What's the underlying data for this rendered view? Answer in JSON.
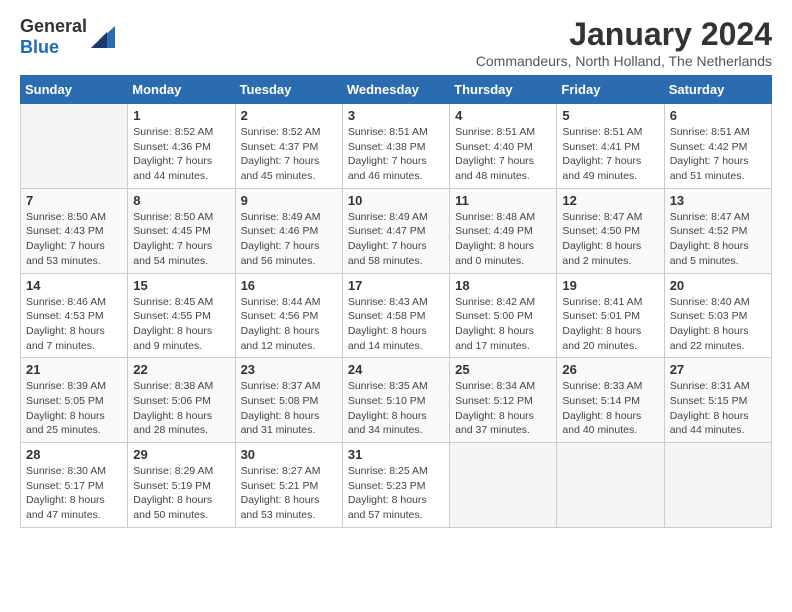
{
  "logo": {
    "general": "General",
    "blue": "Blue"
  },
  "header": {
    "month_title": "January 2024",
    "subtitle": "Commandeurs, North Holland, The Netherlands"
  },
  "days_of_week": [
    "Sunday",
    "Monday",
    "Tuesday",
    "Wednesday",
    "Thursday",
    "Friday",
    "Saturday"
  ],
  "weeks": [
    [
      {
        "day": "",
        "info": ""
      },
      {
        "day": "1",
        "info": "Sunrise: 8:52 AM\nSunset: 4:36 PM\nDaylight: 7 hours\nand 44 minutes."
      },
      {
        "day": "2",
        "info": "Sunrise: 8:52 AM\nSunset: 4:37 PM\nDaylight: 7 hours\nand 45 minutes."
      },
      {
        "day": "3",
        "info": "Sunrise: 8:51 AM\nSunset: 4:38 PM\nDaylight: 7 hours\nand 46 minutes."
      },
      {
        "day": "4",
        "info": "Sunrise: 8:51 AM\nSunset: 4:40 PM\nDaylight: 7 hours\nand 48 minutes."
      },
      {
        "day": "5",
        "info": "Sunrise: 8:51 AM\nSunset: 4:41 PM\nDaylight: 7 hours\nand 49 minutes."
      },
      {
        "day": "6",
        "info": "Sunrise: 8:51 AM\nSunset: 4:42 PM\nDaylight: 7 hours\nand 51 minutes."
      }
    ],
    [
      {
        "day": "7",
        "info": "Sunrise: 8:50 AM\nSunset: 4:43 PM\nDaylight: 7 hours\nand 53 minutes."
      },
      {
        "day": "8",
        "info": "Sunrise: 8:50 AM\nSunset: 4:45 PM\nDaylight: 7 hours\nand 54 minutes."
      },
      {
        "day": "9",
        "info": "Sunrise: 8:49 AM\nSunset: 4:46 PM\nDaylight: 7 hours\nand 56 minutes."
      },
      {
        "day": "10",
        "info": "Sunrise: 8:49 AM\nSunset: 4:47 PM\nDaylight: 7 hours\nand 58 minutes."
      },
      {
        "day": "11",
        "info": "Sunrise: 8:48 AM\nSunset: 4:49 PM\nDaylight: 8 hours\nand 0 minutes."
      },
      {
        "day": "12",
        "info": "Sunrise: 8:47 AM\nSunset: 4:50 PM\nDaylight: 8 hours\nand 2 minutes."
      },
      {
        "day": "13",
        "info": "Sunrise: 8:47 AM\nSunset: 4:52 PM\nDaylight: 8 hours\nand 5 minutes."
      }
    ],
    [
      {
        "day": "14",
        "info": "Sunrise: 8:46 AM\nSunset: 4:53 PM\nDaylight: 8 hours\nand 7 minutes."
      },
      {
        "day": "15",
        "info": "Sunrise: 8:45 AM\nSunset: 4:55 PM\nDaylight: 8 hours\nand 9 minutes."
      },
      {
        "day": "16",
        "info": "Sunrise: 8:44 AM\nSunset: 4:56 PM\nDaylight: 8 hours\nand 12 minutes."
      },
      {
        "day": "17",
        "info": "Sunrise: 8:43 AM\nSunset: 4:58 PM\nDaylight: 8 hours\nand 14 minutes."
      },
      {
        "day": "18",
        "info": "Sunrise: 8:42 AM\nSunset: 5:00 PM\nDaylight: 8 hours\nand 17 minutes."
      },
      {
        "day": "19",
        "info": "Sunrise: 8:41 AM\nSunset: 5:01 PM\nDaylight: 8 hours\nand 20 minutes."
      },
      {
        "day": "20",
        "info": "Sunrise: 8:40 AM\nSunset: 5:03 PM\nDaylight: 8 hours\nand 22 minutes."
      }
    ],
    [
      {
        "day": "21",
        "info": "Sunrise: 8:39 AM\nSunset: 5:05 PM\nDaylight: 8 hours\nand 25 minutes."
      },
      {
        "day": "22",
        "info": "Sunrise: 8:38 AM\nSunset: 5:06 PM\nDaylight: 8 hours\nand 28 minutes."
      },
      {
        "day": "23",
        "info": "Sunrise: 8:37 AM\nSunset: 5:08 PM\nDaylight: 8 hours\nand 31 minutes."
      },
      {
        "day": "24",
        "info": "Sunrise: 8:35 AM\nSunset: 5:10 PM\nDaylight: 8 hours\nand 34 minutes."
      },
      {
        "day": "25",
        "info": "Sunrise: 8:34 AM\nSunset: 5:12 PM\nDaylight: 8 hours\nand 37 minutes."
      },
      {
        "day": "26",
        "info": "Sunrise: 8:33 AM\nSunset: 5:14 PM\nDaylight: 8 hours\nand 40 minutes."
      },
      {
        "day": "27",
        "info": "Sunrise: 8:31 AM\nSunset: 5:15 PM\nDaylight: 8 hours\nand 44 minutes."
      }
    ],
    [
      {
        "day": "28",
        "info": "Sunrise: 8:30 AM\nSunset: 5:17 PM\nDaylight: 8 hours\nand 47 minutes."
      },
      {
        "day": "29",
        "info": "Sunrise: 8:29 AM\nSunset: 5:19 PM\nDaylight: 8 hours\nand 50 minutes."
      },
      {
        "day": "30",
        "info": "Sunrise: 8:27 AM\nSunset: 5:21 PM\nDaylight: 8 hours\nand 53 minutes."
      },
      {
        "day": "31",
        "info": "Sunrise: 8:25 AM\nSunset: 5:23 PM\nDaylight: 8 hours\nand 57 minutes."
      },
      {
        "day": "",
        "info": ""
      },
      {
        "day": "",
        "info": ""
      },
      {
        "day": "",
        "info": ""
      }
    ]
  ]
}
